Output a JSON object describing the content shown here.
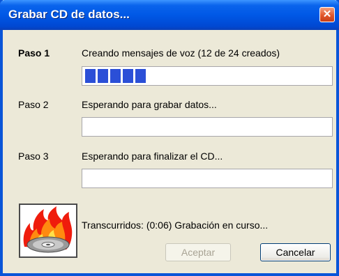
{
  "window": {
    "title": "Grabar CD de datos..."
  },
  "steps": [
    {
      "label": "Paso 1",
      "text": "Creando mensajes de voz (12 de 24 creados)",
      "progress": 0.27,
      "active": true
    },
    {
      "label": "Paso 2",
      "text": "Esperando para grabar datos...",
      "progress": 0,
      "active": false
    },
    {
      "label": "Paso 3",
      "text": "Esperando para finalizar el CD...",
      "progress": 0,
      "active": false
    }
  ],
  "status": {
    "text": "Transcurridos: (0:06) Grabación en curso..."
  },
  "buttons": {
    "accept_label": "Aceptar",
    "cancel_label": "Cancelar"
  },
  "icons": {
    "close": "close-icon",
    "burn": "burning-cd-icon"
  },
  "colors": {
    "titlebar": "#0058e6",
    "progress": "#2b4fd7",
    "close": "#e2572c"
  }
}
